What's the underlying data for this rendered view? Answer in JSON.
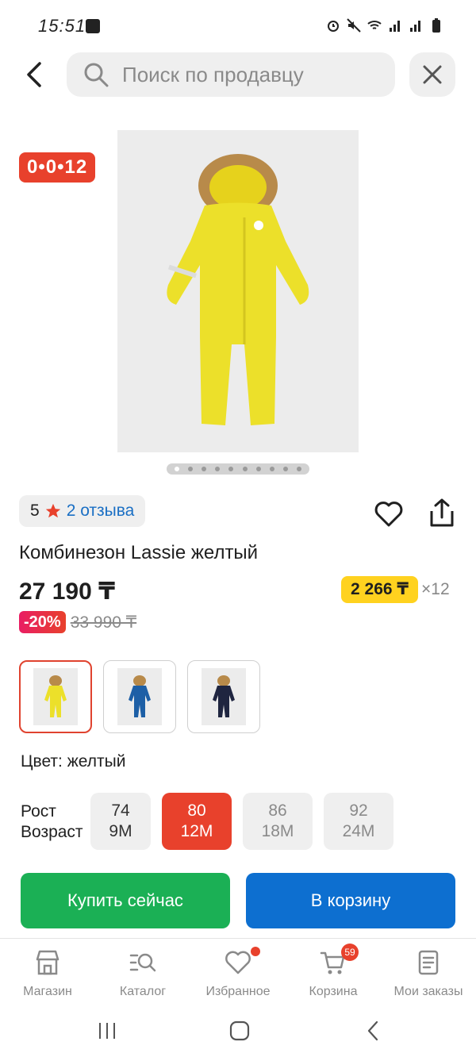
{
  "status_bar": {
    "time": "15:51"
  },
  "search": {
    "placeholder": "Поиск по продавцу"
  },
  "product": {
    "promo_badge": "0•0•12",
    "rating": "5",
    "reviews": "2 отзыва",
    "title": "Комбинезон Lassie желтый",
    "price": "27 190 ₸",
    "installment_amount": "2 266 ₸",
    "installment_months": "×12",
    "discount": "-20%",
    "old_price": "33 990 ₸",
    "color_label": "Цвет: желтый",
    "colors": [
      "#f2e12a",
      "#1d5fa6",
      "#1f2540"
    ],
    "selected_color_index": 0,
    "image_count": 10,
    "current_image": 0
  },
  "sizes": {
    "row_label_1": "Рост",
    "row_label_2": "Возраст",
    "items": [
      {
        "height": "74",
        "age": "9M",
        "state": "available"
      },
      {
        "height": "80",
        "age": "12M",
        "state": "selected"
      },
      {
        "height": "86",
        "age": "18M",
        "state": "unavailable"
      },
      {
        "height": "92",
        "age": "24M",
        "state": "unavailable"
      }
    ]
  },
  "actions": {
    "buy_now": "Купить сейчас",
    "add_to_cart": "В корзину"
  },
  "bottom_nav": {
    "items": [
      {
        "label": "Магазин",
        "icon": "store-icon"
      },
      {
        "label": "Каталог",
        "icon": "catalog-search-icon"
      },
      {
        "label": "Избранное",
        "icon": "heart-icon"
      },
      {
        "label": "Корзина",
        "icon": "cart-icon",
        "badge": "59"
      },
      {
        "label": "Мои заказы",
        "icon": "orders-icon"
      }
    ]
  }
}
